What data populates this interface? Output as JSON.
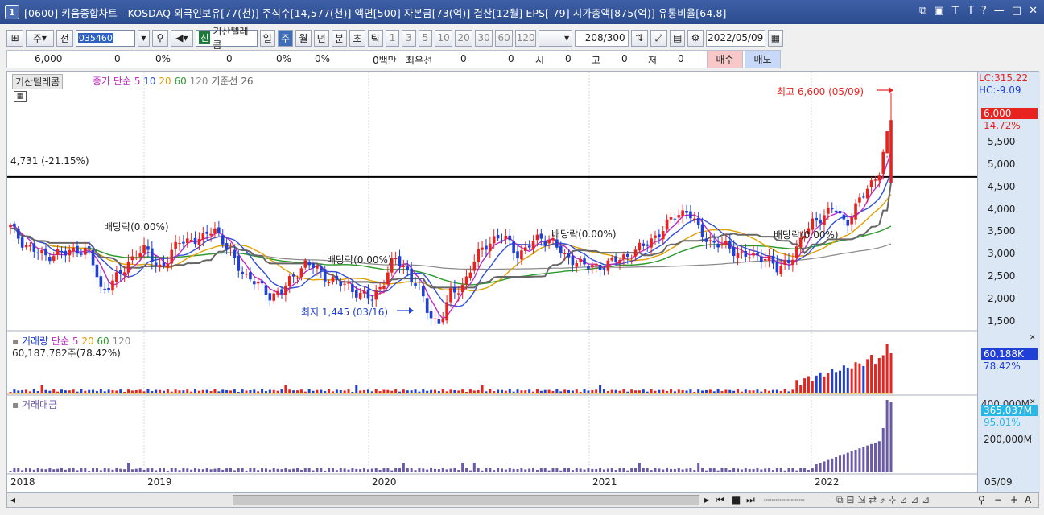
{
  "window": {
    "number": "1",
    "title": "[0600] 키움종합차트 - KOSDAQ 외국인보유[77(천)] 주식수[14,577(천)] 액면[500] 자본금[73(억)] 결산[12월] EPS[-79] 시가총액[875(억)] 유통비율[64.8]",
    "buttons": [
      "⧉",
      "▣",
      "⊤",
      "T",
      "?",
      "—",
      "□",
      "✕"
    ]
  },
  "toolbar": {
    "period_select": "주",
    "prev_label": "전",
    "code": "035460",
    "sin_label": "신",
    "stock_name": "기산텔레콤",
    "period_tabs": [
      "일",
      "주",
      "월",
      "년",
      "분",
      "초",
      "틱"
    ],
    "period_selected": "주",
    "intervals": [
      "1",
      "3",
      "5",
      "10",
      "20",
      "30",
      "60",
      "120"
    ],
    "count": "208",
    "count_total": "/300",
    "date": "2022/05/09"
  },
  "quote": {
    "price": "6,000",
    "change": "0",
    "change_pct": "0%",
    "volume": "0",
    "vol_pct": "0%",
    "pct2": "0%",
    "amount": "0백만",
    "best_label": "최우선",
    "best1": "0",
    "best2": "0",
    "open_label": "시",
    "open": "0",
    "high_label": "고",
    "high": "0",
    "low_label": "저",
    "low": "0",
    "buy": "매수",
    "sell": "매도"
  },
  "price_panel": {
    "title": "기산텔레콤",
    "ma_label": "종가 단순",
    "ma_periods": [
      "5",
      "10",
      "20",
      "60",
      "120"
    ],
    "baseline_label": "기준선 26",
    "hline_label": "4,731 (-21.15%)",
    "high_ann": "최고 6,600 (05/09)",
    "low_ann": "최저 1,445 (03/16)",
    "div_labels": [
      "배당락(0.00%)",
      "배당락(0.00%)",
      "배당락(0.00%)",
      "배당락(0.00%)"
    ],
    "lc": "LC:315.22",
    "hc": "HC:-9.09",
    "cur_price": "6,000",
    "cur_pct": "14.72%",
    "yticks": [
      "5,500",
      "5,000",
      "4,500",
      "4,000",
      "3,500",
      "3,000",
      "2,500",
      "2,000",
      "1,500"
    ]
  },
  "volume_panel": {
    "title": "거래량",
    "ma_label": "단순",
    "ma_periods": [
      "5",
      "20",
      "60",
      "120"
    ],
    "value_text": "60,187,782주(78.42%)",
    "cur": "60,188K",
    "cur_pct": "78.42%"
  },
  "amount_panel": {
    "title": "거래대금",
    "top_tick": "400,000M",
    "tick": "200,000M",
    "cur": "365,037M",
    "cur_pct": "95.01%"
  },
  "x_axis": {
    "labels": [
      "2018",
      "2019",
      "2020",
      "2021",
      "2022"
    ],
    "last_date": "05/09"
  },
  "colors": {
    "up": "#e8231f",
    "down": "#1f3fd6",
    "ma5": "#c02ac0",
    "ma10": "#3050d8",
    "ma20": "#e0a000",
    "ma60": "#2a9a2a",
    "ma120": "#888888",
    "baseline": "#666666",
    "amount": "#6a5aa8"
  },
  "chart_data": {
    "type": "candlestick",
    "x_labels": [
      "2018",
      "2019",
      "2020",
      "2021",
      "2022"
    ],
    "ylim": [
      1300,
      6900
    ],
    "weekly_close_approx": [
      3600,
      3300,
      3100,
      2950,
      3050,
      3000,
      3150,
      3050,
      2200,
      2400,
      2600,
      3050,
      3100,
      2700,
      2900,
      3300,
      3350,
      3300,
      3650,
      3200,
      2800,
      2500,
      2300,
      2100,
      2150,
      2500,
      2800,
      2700,
      2500,
      2350,
      2300,
      2100,
      2000,
      2400,
      2900,
      2700,
      2300,
      1700,
      1445,
      2100,
      2300,
      2800,
      3200,
      3400,
      3300,
      3000,
      3200,
      3400,
      3300,
      2950,
      2900,
      2700,
      2750,
      2800,
      2900,
      3050,
      3150,
      3400,
      3600,
      3900,
      4000,
      3500,
      3300,
      3200,
      3100,
      3000,
      2900,
      3000,
      2600,
      2900,
      3300,
      3700,
      3900,
      4000,
      3700,
      4100,
      4500,
      4900,
      6000
    ],
    "high": 6600,
    "high_date": "05/09",
    "low": 1445,
    "low_date": "03/16",
    "reference_line": 4731
  }
}
